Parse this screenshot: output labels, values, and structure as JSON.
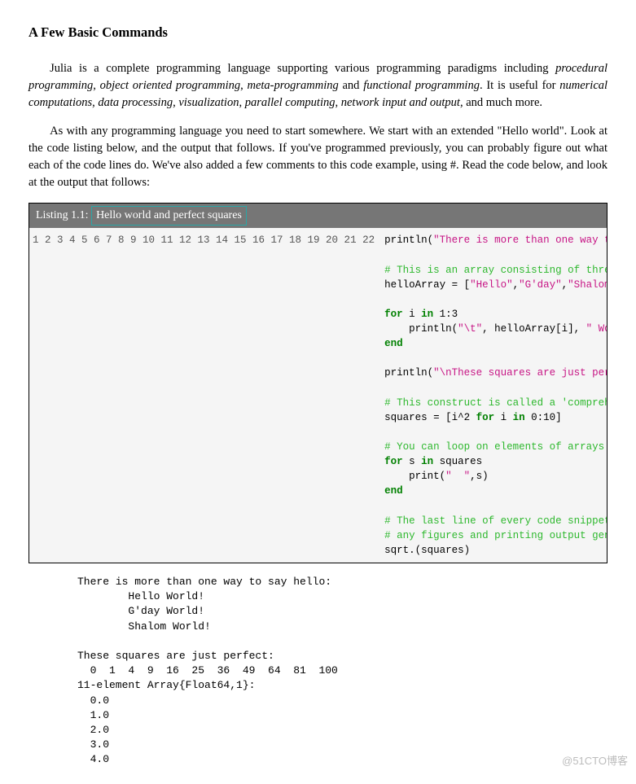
{
  "heading": "A Few Basic Commands",
  "para1": {
    "t0": "Julia is a complete programming language supporting various programming paradigms including ",
    "i0": "procedural programming",
    "t1": ", ",
    "i1": "object oriented programming",
    "t2": ", ",
    "i2": "meta-programming",
    "t3": " and ",
    "i3": "functional programming",
    "t4": ". It is useful for ",
    "i4": "numerical computations",
    "t5": ", ",
    "i5": "data processing",
    "t6": ", ",
    "i6": "visualization",
    "t7": ", ",
    "i7": "parallel computing",
    "t8": ", ",
    "i8": "network input and output",
    "t9": ", and much more."
  },
  "para2": "As with any programming language you need to start somewhere. We start with an extended \"Hello world\". Look at the code listing below, and the output that follows. If you've programmed previously, you can probably figure out what each of the code lines do. We've also added a few comments to this code example, using #. Read the code below, and look at the output that follows:",
  "listing": {
    "label": "Listing 1.1: ",
    "title": "Hello world and perfect squares",
    "lines": 22,
    "code": {
      "l1a": "println(",
      "l1b": "\"There is more than one way to say hello:\"",
      "l1c": ")",
      "l3": "# This is an array consisting of three strings",
      "l4a": "helloArray = [",
      "l4b": "\"Hello\"",
      "l4c": ",",
      "l4d": "\"G'day\"",
      "l4e": ",",
      "l4f": "\"Shalom\"",
      "l4g": "]",
      "l6a": "for",
      "l6b": " i ",
      "l6c": "in",
      "l6d": " 1:3",
      "l7a": "    println(",
      "l7b": "\"\\t\"",
      "l7c": ", helloArray[i], ",
      "l7d": "\" World!\"",
      "l7e": ")",
      "l8": "end",
      "l10a": "println(",
      "l10b": "\"\\nThese squares are just perfect:\"",
      "l10c": ")",
      "l12": "# This construct is called a 'comprehension' (or 'list comprehension')",
      "l13a": "squares = [i^2 ",
      "l13b": "for",
      "l13c": " i ",
      "l13d": "in",
      "l13e": " 0:10]",
      "l15": "# You can loop on elements of arrays without having to use indexing",
      "l16a": "for",
      "l16b": " s ",
      "l16c": "in",
      "l16d": " squares",
      "l17a": "    print(",
      "l17b": "\"  \"",
      "l17c": ",s)",
      "l18": "end",
      "l20": "# The last line of every code snippet is also evaluated as output (in addition to",
      "l21": "# any figures and printing output generated previously).",
      "l22": "sqrt.(squares)"
    }
  },
  "output": "There is more than one way to say hello:\n        Hello World!\n        G'day World!\n        Shalom World!\n\nThese squares are just perfect:\n  0  1  4  9  16  25  36  49  64  81  100\n11-element Array{Float64,1}:\n  0.0\n  1.0\n  2.0\n  3.0\n  4.0",
  "watermark": "@51CTO博客"
}
